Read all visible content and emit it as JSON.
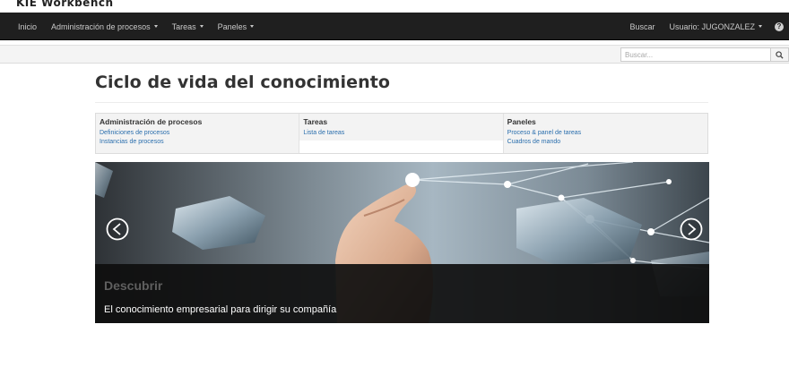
{
  "brand": "KIE Workbench",
  "nav": {
    "items": [
      {
        "label": "Inicio",
        "dropdown": false
      },
      {
        "label": "Administración de procesos",
        "dropdown": true
      },
      {
        "label": "Tareas",
        "dropdown": true
      },
      {
        "label": "Paneles",
        "dropdown": true
      }
    ],
    "search_label": "Buscar",
    "user_label": "Usuario: JUGONZALEZ",
    "help_glyph": "?"
  },
  "search": {
    "placeholder": "Buscar..."
  },
  "page_title": "Ciclo de vida del conocimiento",
  "menu": [
    {
      "heading": "Administración de procesos",
      "links": [
        "Definiciones de procesos",
        "Instancias de procesos"
      ]
    },
    {
      "heading": "Tareas",
      "links": [
        "Lista de tareas"
      ]
    },
    {
      "heading": "Paneles",
      "links": [
        "Proceso & panel de tareas",
        "Cuadros de mando"
      ]
    }
  ],
  "carousel": {
    "title": "Descubrir",
    "caption": "El conocimiento empresarial para dirigir su compañía"
  },
  "colors": {
    "navbar": "#1f1f1f",
    "link": "#2a6ead",
    "caption_band": "#0e0e0e"
  }
}
